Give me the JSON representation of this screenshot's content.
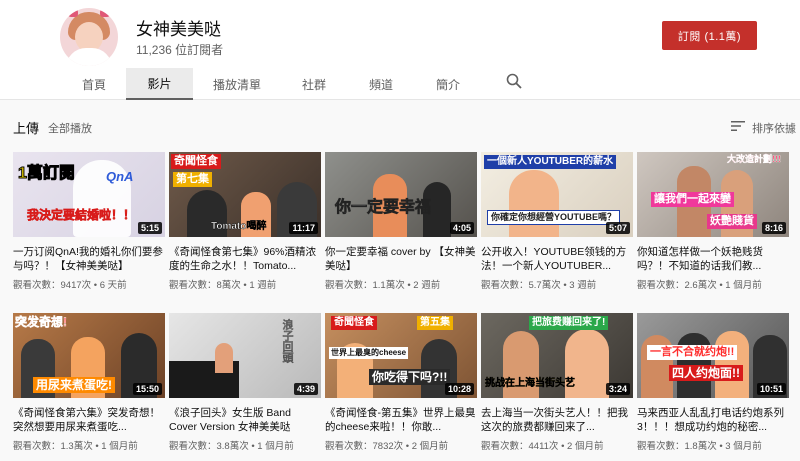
{
  "channel": {
    "name": "女神美美哒",
    "subscribers": "11,236 位訂閱者",
    "subscribe_label": "訂閱 (1.1萬)"
  },
  "tabs": [
    {
      "label": "首頁"
    },
    {
      "label": "影片"
    },
    {
      "label": "播放清單"
    },
    {
      "label": "社群"
    },
    {
      "label": "頻道"
    },
    {
      "label": "簡介"
    }
  ],
  "active_tab": "影片",
  "search_icon": "search-icon",
  "uploads": {
    "title": "上傳",
    "play_all": "全部播放",
    "sort_label": "排序依據",
    "sort_icon": "sort-lines-icon"
  },
  "videos": [
    {
      "title": "一万订阅QnA!我的婚礼你们要参与吗？！【女神美美哒】",
      "meta": "觀看次數：9417次 • 6 天前",
      "duration": "5:15",
      "captions": [
        "1萬訂閱",
        "QnA",
        "我決定要結婚啦！！"
      ]
    },
    {
      "title": "《奇闻怪食第七集》96%酒精浓度的生命之水！！Tomato...",
      "meta": "觀看次數：8萬次 • 1 週前",
      "duration": "11:17",
      "captions": [
        "奇聞怪食",
        "第七集",
        "Tomato喝醉"
      ]
    },
    {
      "title": "你一定要幸福 cover by 【女神美美哒】",
      "meta": "觀看次數：1.1萬次 • 2 週前",
      "duration": "4:05",
      "captions": [
        "你一定要幸福"
      ]
    },
    {
      "title": "公开收入！YOUTUBE领钱的方法！一个新人YOUTUBER...",
      "meta": "觀看次數：5.7萬次 • 3 週前",
      "duration": "5:07",
      "captions": [
        "一個新人YOUTUBER的薪水",
        "你確定你想經營YOUTUBE嗎？"
      ]
    },
    {
      "title": "你知道怎样做一个妖艳贱货吗？！不知道的话我们教...",
      "meta": "觀看次數：2.6萬次 • 1 個月前",
      "duration": "8:16",
      "captions": [
        "大改造計劃!!!",
        "讓我們一起來變",
        "妖艷賤貨"
      ]
    },
    {
      "title": "《奇闻怪食第六集》突发奇想！突然想要用尿来煮蛋吃...",
      "meta": "觀看次數：1.3萬次 • 1 個月前",
      "duration": "15:50",
      "captions": [
        "突发奇想!",
        "用尿来煮蛋吃!"
      ]
    },
    {
      "title": "《浪子回头》女生版 Band Cover Version 女神美美哒",
      "meta": "觀看次數：3.8萬次 • 1 個月前",
      "duration": "4:39",
      "captions": [
        "浪子回頭"
      ]
    },
    {
      "title": "《奇闻怪食-第五集》世界上最臭的cheese来啦！！你敢...",
      "meta": "觀看次數：7832次 • 2 個月前",
      "duration": "10:28",
      "captions": [
        "奇聞怪食",
        "第五集",
        "世界上最臭的cheese",
        "你吃得下吗?!!"
      ]
    },
    {
      "title": "去上海当一次街头艺人！！把我这次的旅费都赚回来了...",
      "meta": "觀看次數：4411次 • 2 個月前",
      "duration": "3:24",
      "captions": [
        "把旅费赚回来了!",
        "挑战在上海当街头艺"
      ]
    },
    {
      "title": "马来西亚人乱乱打电话约炮系列3！！！想成功约炮的秘密...",
      "meta": "觀看次數：1.8萬次 • 3 個月前",
      "duration": "10:51",
      "captions": [
        "一言不合就约炮!!",
        "四人约炮面!!"
      ]
    }
  ],
  "colors": {
    "subscribe": "#c4302b",
    "meta_text": "#606060"
  }
}
